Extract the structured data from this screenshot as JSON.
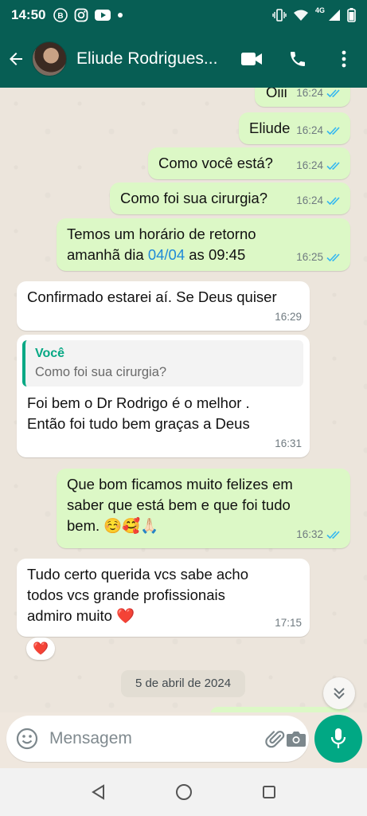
{
  "status_bar": {
    "time": "14:50",
    "network": "4G"
  },
  "header": {
    "contact_name": "Eliude Rodrigues..."
  },
  "messages": [
    {
      "dir": "out",
      "text": "Oiii",
      "time": "16:24"
    },
    {
      "dir": "out",
      "text": "Eliude",
      "time": "16:24"
    },
    {
      "dir": "out",
      "text": "Como você está?",
      "time": "16:24"
    },
    {
      "dir": "out",
      "text": "Como foi sua cirurgia?",
      "time": "16:24"
    },
    {
      "dir": "out",
      "text_line1": "Temos um horário de retorno",
      "text_pre": "amanhã dia ",
      "text_link": "04/04",
      "text_post": " as 09:45",
      "time": "16:25"
    },
    {
      "dir": "in",
      "text": "Confirmado estarei aí. Se Deus quiser",
      "time": "16:29"
    },
    {
      "dir": "in",
      "quote_author": "Você",
      "quote_text": "Como foi sua cirurgia?",
      "text_line1": "Foi bem o Dr Rodrigo é o melhor .",
      "text_line2": "Então foi tudo bem graças a Deus",
      "time": "16:31"
    },
    {
      "dir": "out",
      "text_line1": "Que bom ficamos muito felizes em",
      "text_line2": "saber que está bem e que foi tudo",
      "text_line3": "bem. ☺️🥰🙏🏻",
      "time": "16:32"
    },
    {
      "dir": "in",
      "text_line1": "Tudo certo querida vcs sabe acho",
      "text_line2": "todos vcs  grande profissionais",
      "text_line3": "admiro muito ❤️",
      "time": "17:15",
      "reaction": "❤️"
    }
  ],
  "date_divider": "5 de abril de 2024",
  "input": {
    "placeholder": "Mensagem"
  },
  "colors": {
    "header": "#075e54",
    "outgoing": "#dcf8c6",
    "incoming": "#ffffff",
    "accent": "#01a884",
    "read_ticks": "#34b7f1"
  },
  "icons": [
    "b-badge-icon",
    "instagram-icon",
    "youtube-icon",
    "vibrate-icon",
    "wifi-icon",
    "signal-icon",
    "battery-icon",
    "back-arrow-icon",
    "video-call-icon",
    "phone-icon",
    "more-vert-icon",
    "double-tick-icon",
    "chevrons-down-icon",
    "emoji-icon",
    "attach-icon",
    "camera-icon",
    "mic-icon",
    "nav-back-icon",
    "nav-home-icon",
    "nav-recents-icon"
  ]
}
